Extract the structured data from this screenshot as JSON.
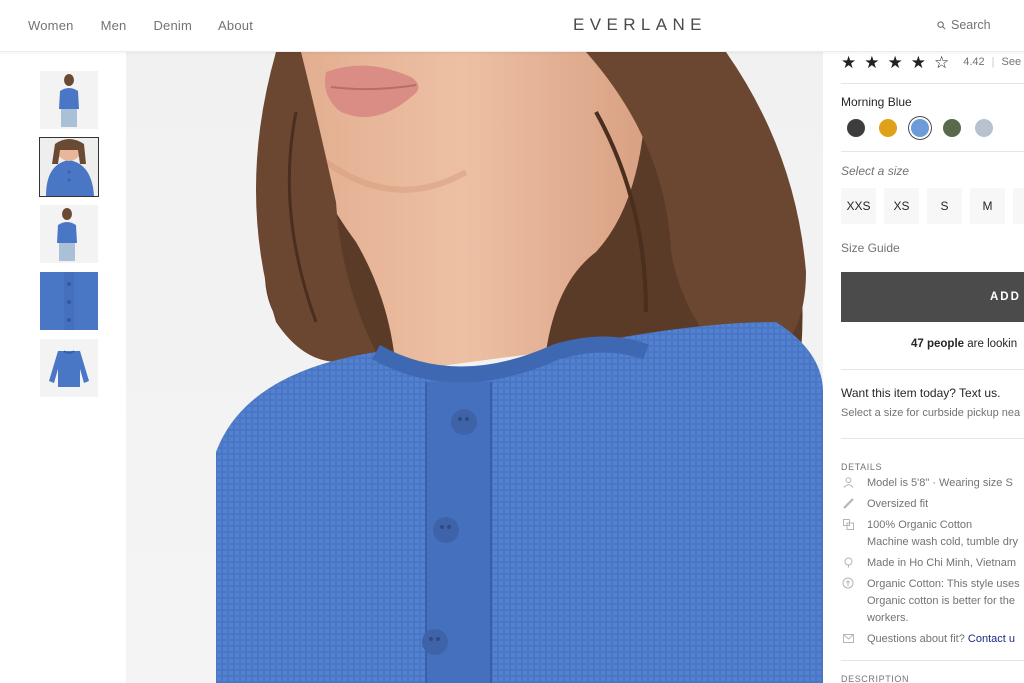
{
  "header": {
    "nav": [
      "Women",
      "Men",
      "Denim",
      "About"
    ],
    "logo": "EVERLANE",
    "search_label": "Search"
  },
  "product": {
    "rating_value": "4.42",
    "rating_link": "See",
    "stars_filled": 4.5,
    "color_name": "Morning Blue",
    "swatches": [
      {
        "name": "charcoal",
        "color": "#3d3d3d"
      },
      {
        "name": "mustard",
        "color": "#e1a01a"
      },
      {
        "name": "morning-blue",
        "color": "#6d9ad9",
        "selected": true
      },
      {
        "name": "olive",
        "color": "#586a4b"
      },
      {
        "name": "light-grey-blue",
        "color": "#b7c1d0"
      }
    ],
    "size_prompt": "Select a size",
    "sizes": [
      "XXS",
      "XS",
      "S",
      "M"
    ],
    "size_guide": "Size Guide",
    "add_button": "ADD",
    "looking_count": "47 people",
    "looking_text": " are lookin",
    "want_today": "Want this item today? Text us.",
    "pickup_text": "Select a size for curbside pickup nea"
  },
  "details": {
    "title": "DETAILS",
    "model": "Model is 5'8\" · Wearing size S",
    "fit": "Oversized fit",
    "material": "100% Organic Cotton",
    "care": "Machine wash cold, tumble dry",
    "made_in": "Made in Ho Chi Minh, Vietnam",
    "organic_line1": "Organic Cotton: This style uses",
    "organic_line2": "Organic cotton is better for the",
    "organic_line3": "workers.",
    "questions": "Questions about fit? ",
    "contact": "Contact u",
    "description_title": "DESCRIPTION"
  },
  "colors": {
    "sweater": "#4a76c6",
    "button_dark": "#4b4b4b"
  }
}
